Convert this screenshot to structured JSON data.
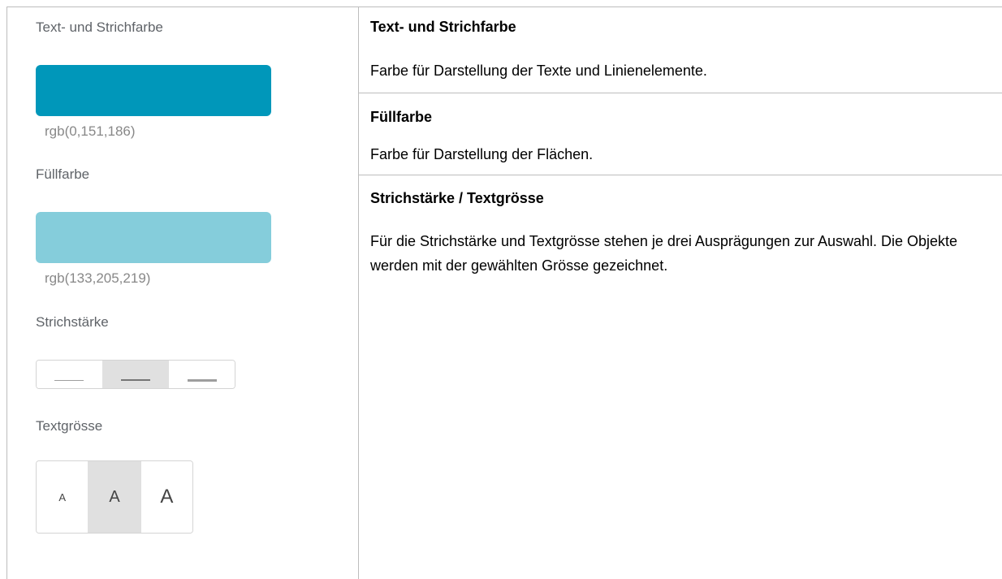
{
  "left": {
    "stroke_color_label": "Text- und Strichfarbe",
    "stroke_color_value": "rgb(0,151,186)",
    "stroke_color_hex": "#0097ba",
    "fill_color_label": "Füllfarbe",
    "fill_color_value": "rgb(133,205,219)",
    "fill_color_hex": "#85cddb",
    "stroke_width_label": "Strichstärke",
    "stroke_width_options": [
      "thin-line-icon",
      "medium-line-icon",
      "thick-line-icon"
    ],
    "stroke_width_selected": 2,
    "text_size_label": "Textgrösse",
    "text_size_options": [
      "A",
      "A",
      "A"
    ],
    "text_size_selected": 2
  },
  "right": {
    "sections": [
      {
        "title": "Text- und Strichfarbe",
        "text": "Farbe für Darstellung der Texte und Linienelemente."
      },
      {
        "title": "Füllfarbe",
        "text": "Farbe für Darstellung der Flächen."
      },
      {
        "title": "Strichstärke / Textgrösse",
        "text": "Für die Strichstärke und Textgrösse stehen je drei Ausprägungen zur Auswahl. Die Objekte werden mit der gewählten Grösse gezeichnet."
      }
    ]
  }
}
